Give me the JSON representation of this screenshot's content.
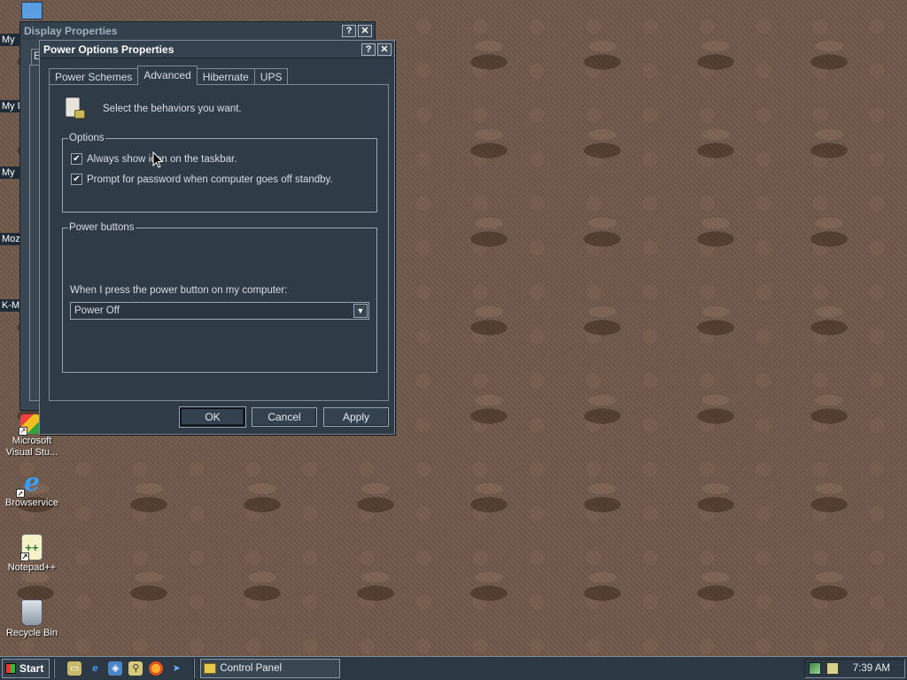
{
  "desktop": {
    "icons": [
      {
        "label": "Microsoft Visual Stu..."
      },
      {
        "label": "Browservice"
      },
      {
        "label": "Notepad++"
      },
      {
        "label": "Recycle Bin"
      }
    ],
    "partial_labels": [
      "My",
      "My D",
      "My",
      "Moz",
      "K-M"
    ]
  },
  "background_window": {
    "title": "Display Properties"
  },
  "dialog": {
    "title": "Power Options Properties",
    "help_button": "?",
    "close_button": "✕",
    "tabs": [
      {
        "label": "Power Schemes",
        "active": false
      },
      {
        "label": "Advanced",
        "active": true
      },
      {
        "label": "Hibernate",
        "active": false
      },
      {
        "label": "UPS",
        "active": false
      }
    ],
    "intro_text": "Select the behaviors you want.",
    "options_group": {
      "legend": "Options",
      "items": [
        {
          "label": "Always show icon on the taskbar.",
          "checked": true
        },
        {
          "label": "Prompt for password when computer goes off standby.",
          "checked": true
        }
      ]
    },
    "power_buttons_group": {
      "legend": "Power buttons",
      "prompt": "When I press the power button on my computer:",
      "selected": "Power Off"
    },
    "buttons": {
      "ok": "OK",
      "cancel": "Cancel",
      "apply": "Apply"
    }
  },
  "taskbar": {
    "start_label": "Start",
    "task_label": "Control Panel",
    "clock": "7:39 AM"
  },
  "colors": {
    "window_bg": "#2f3b47",
    "titlebar_bg": "#34414e",
    "border": "#9aa6b2",
    "desktop": "#6e584a"
  }
}
